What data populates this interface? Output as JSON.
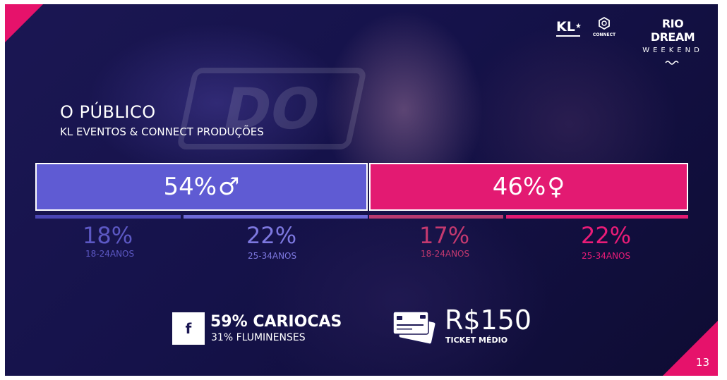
{
  "header": {
    "title": "O PÚBLICO",
    "subtitle": "KL EVENTOS & CONNECT PRODUÇÕES"
  },
  "logos": {
    "kl": "KL",
    "connect": "CONNECT",
    "rio_dream": "RIO DREAM",
    "weekend": "WEEKEND"
  },
  "gender": {
    "male": {
      "percent": "54%",
      "symbol": "♂",
      "color": "#5f5bd3"
    },
    "female": {
      "percent": "46%",
      "symbol": "♀",
      "color": "#e31a72"
    }
  },
  "age_groups": [
    {
      "percent": "18%",
      "label": "18-24ANOS"
    },
    {
      "percent": "22%",
      "label": "25-34ANOS"
    },
    {
      "percent": "17%",
      "label": "18-24ANOS"
    },
    {
      "percent": "22%",
      "label": "25-34ANOS"
    }
  ],
  "stats": {
    "origin_main": "59% CARIOCAS",
    "origin_sub": "31% FLUMINENSES",
    "price": "R$150",
    "price_label": "TICKET MÉDIO"
  },
  "icons": {
    "facebook": "facebook-icon",
    "card": "credit-card-icon"
  },
  "page_number": "13",
  "colors": {
    "accent": "#e6126b",
    "background": "#15124a"
  }
}
